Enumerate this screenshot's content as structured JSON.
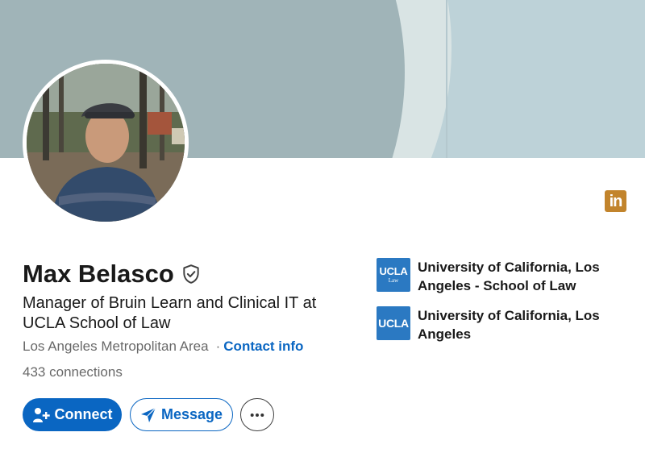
{
  "profile": {
    "name": "Max Belasco",
    "headline": "Manager of Bruin Learn and Clinical IT at UCLA School of Law",
    "location": "Los Angeles Metropolitan Area",
    "separator": "·",
    "contact_info_label": "Contact info",
    "connections_count": "433",
    "connections_label": "connections",
    "verified_icon": "shield-check-icon"
  },
  "actions": {
    "connect_label": "Connect",
    "connect_icon": "add-person-icon",
    "message_label": "Message",
    "message_icon": "paper-plane-icon",
    "more_label": "•••",
    "more_icon": "more-options-icon"
  },
  "brand": {
    "badge_text": "in",
    "badge_color": "#c2842c"
  },
  "education": [
    {
      "logo_main": "UCLA",
      "logo_sub": "Law",
      "name": "University of California, Los Angeles - School of Law"
    },
    {
      "logo_main": "UCLA",
      "logo_sub": "",
      "name": "University of California, Los Angeles"
    }
  ],
  "colors": {
    "primary": "#0a66c2",
    "banner": "#bdd2d8",
    "banner_dark": "#a0b4b8",
    "school_logo": "#2b79c2"
  }
}
